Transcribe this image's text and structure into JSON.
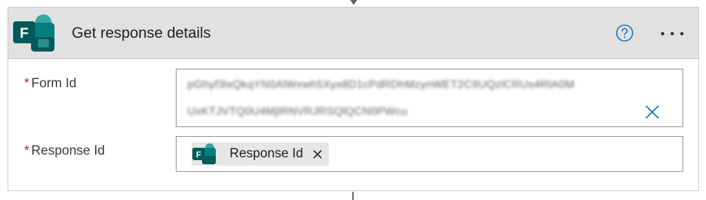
{
  "action": {
    "title": "Get response details",
    "icon": "microsoft-forms-icon",
    "help_icon": "question-circle-icon",
    "more_icon": "ellipsis-icon"
  },
  "fields": {
    "form_id": {
      "required_marker": "*",
      "label": "Form Id",
      "value_line1": "pGhyf3lxQkqYN0AlWxwh5Xyx8D1cPdRDhMzynWET2C9UQzlCRUs4RlA0M",
      "value_line2": "UxKTJVTQ0U4MjlRNVRJRSQlQCN0PWcu",
      "clear_icon": "close-icon"
    },
    "response_id": {
      "required_marker": "*",
      "label": "Response Id",
      "token_label": "Response Id",
      "token_icon": "microsoft-forms-icon",
      "token_remove_icon": "close-icon"
    }
  },
  "colors": {
    "forms_dark": "#035a5a",
    "forms_mid": "#077d7d",
    "forms_light": "#39a6a6",
    "accent_blue": "#0f6cbd",
    "required_red": "#a4262c",
    "header_bg": "#e1e1e1"
  }
}
